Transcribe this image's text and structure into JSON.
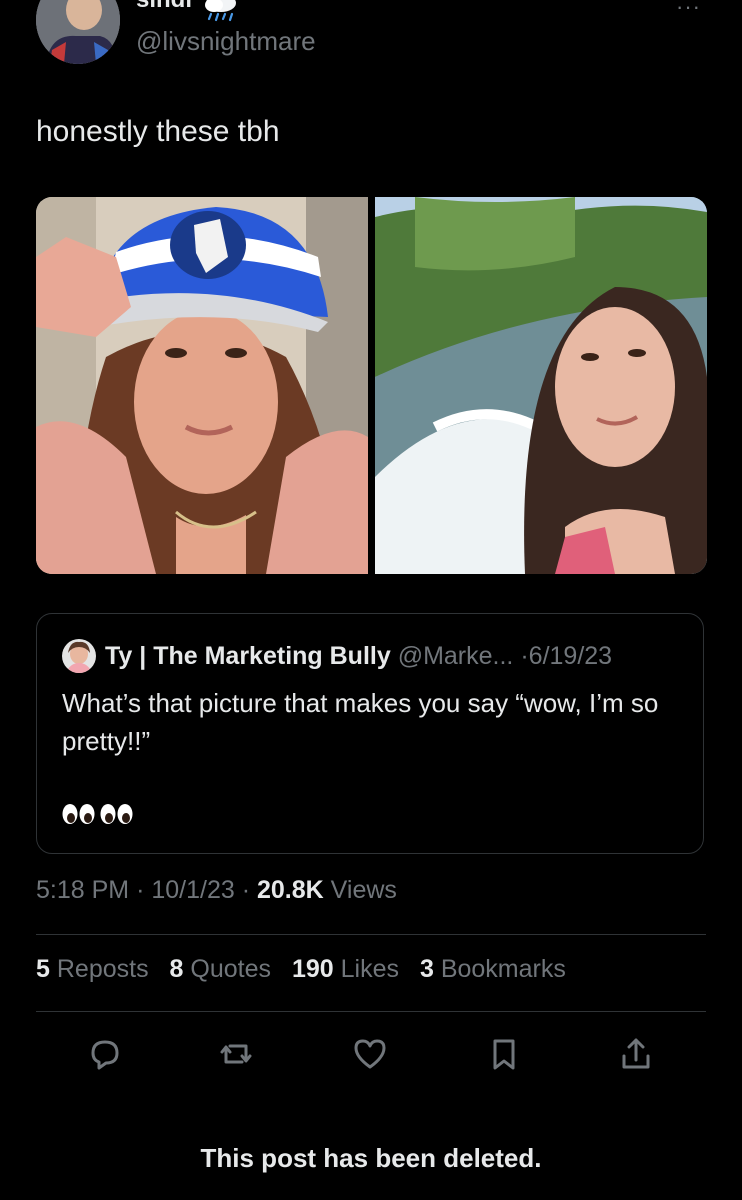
{
  "post": {
    "display_name": "sindi",
    "name_emoji_icon": "rain-cloud-icon",
    "handle": "@livsnightmare",
    "text": "honestly these tbh",
    "more_icon": "more-icon",
    "more_label": "···"
  },
  "quote": {
    "author_name": "Ty | The Marketing Bully",
    "author_handle": "@Marke...",
    "separator": "·",
    "date": "6/19/23",
    "text": "What’s that picture that makes you say “wow, I’m so pretty!!”",
    "emoji_icons": [
      "eyes-icon",
      "eyes-icon"
    ]
  },
  "meta": {
    "time": "5:18 PM",
    "sep": "·",
    "date": "10/1/23",
    "views_count": "20.8K",
    "views_label": "Views"
  },
  "stats": {
    "reposts_count": "5",
    "reposts_label": "Reposts",
    "quotes_count": "8",
    "quotes_label": "Quotes",
    "likes_count": "190",
    "likes_label": "Likes",
    "bookmarks_count": "3",
    "bookmarks_label": "Bookmarks"
  },
  "actions": [
    "reply-icon",
    "repost-icon",
    "like-icon",
    "bookmark-icon",
    "share-icon"
  ],
  "footer": {
    "deleted_text": "This post has been deleted."
  },
  "colors": {
    "background": "#000000",
    "primary_text": "#e7e9ea",
    "secondary_text": "#71767b",
    "border": "#2f3336"
  }
}
